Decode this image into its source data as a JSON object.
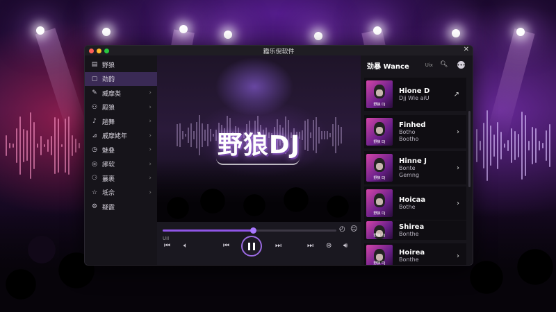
{
  "window": {
    "title": "籀乐倪软件"
  },
  "sidebar": {
    "items": [
      {
        "icon": "album-icon",
        "glyph": "▤",
        "label": "野狼",
        "chevron": ""
      },
      {
        "icon": "square-icon",
        "glyph": "▢",
        "label": "劲韵",
        "chevron": ""
      },
      {
        "icon": "pen-icon",
        "glyph": "✎",
        "label": "臧摩类",
        "chevron": "›"
      },
      {
        "icon": "person-icon",
        "glyph": "⚇",
        "label": "殿狼",
        "chevron": "›"
      },
      {
        "icon": "microphone-icon",
        "glyph": "♪",
        "label": "趟舞",
        "chevron": "›"
      },
      {
        "icon": "chart-icon",
        "glyph": "⊿",
        "label": "戚摩姥年",
        "chevron": "›"
      },
      {
        "icon": "clock-icon",
        "glyph": "◷",
        "label": "魅叠",
        "chevron": "›"
      },
      {
        "icon": "disc-icon",
        "glyph": "◎",
        "label": "謻软",
        "chevron": "›"
      },
      {
        "icon": "users-icon",
        "glyph": "⚆",
        "label": "蕞裹",
        "chevron": "›"
      },
      {
        "icon": "star-icon",
        "glyph": "☆",
        "label": "坻佘",
        "chevron": "›"
      },
      {
        "icon": "settings-icon",
        "glyph": "⚙",
        "label": "疑霰",
        "chevron": ""
      }
    ]
  },
  "player": {
    "art_title": "野狼DJ",
    "time_label": "UiI",
    "progress": 0.52,
    "accent": "#8f55e6"
  },
  "panel": {
    "title": "劲暴 Wance",
    "tag": "Uix",
    "tracks": [
      {
        "name": "Hione D",
        "sub1": "Djj Wie aiU",
        "sub2": "",
        "action": "↗",
        "thumb_caption": "野狼 DJ"
      },
      {
        "name": "Finhed",
        "sub1": "Botho",
        "sub2": "Bootho",
        "action": "›",
        "thumb_caption": "野狼 DJ"
      },
      {
        "name": "Hinne J",
        "sub1": "Bonte",
        "sub2": "Gemng",
        "action": "›",
        "thumb_caption": "野狼 DJ"
      },
      {
        "name": "Hoicaa",
        "sub1": "Bothe",
        "sub2": "",
        "action": "›",
        "thumb_caption": "野狼 DJ"
      },
      {
        "name": "Shirea",
        "sub1": "Bonthe",
        "sub2": "",
        "action": "",
        "thumb_caption": "野狼 DJ"
      },
      {
        "name": "Hoirea",
        "sub1": "Bonthe",
        "sub2": "",
        "action": "›",
        "thumb_caption": "野狼 DJ"
      }
    ]
  }
}
